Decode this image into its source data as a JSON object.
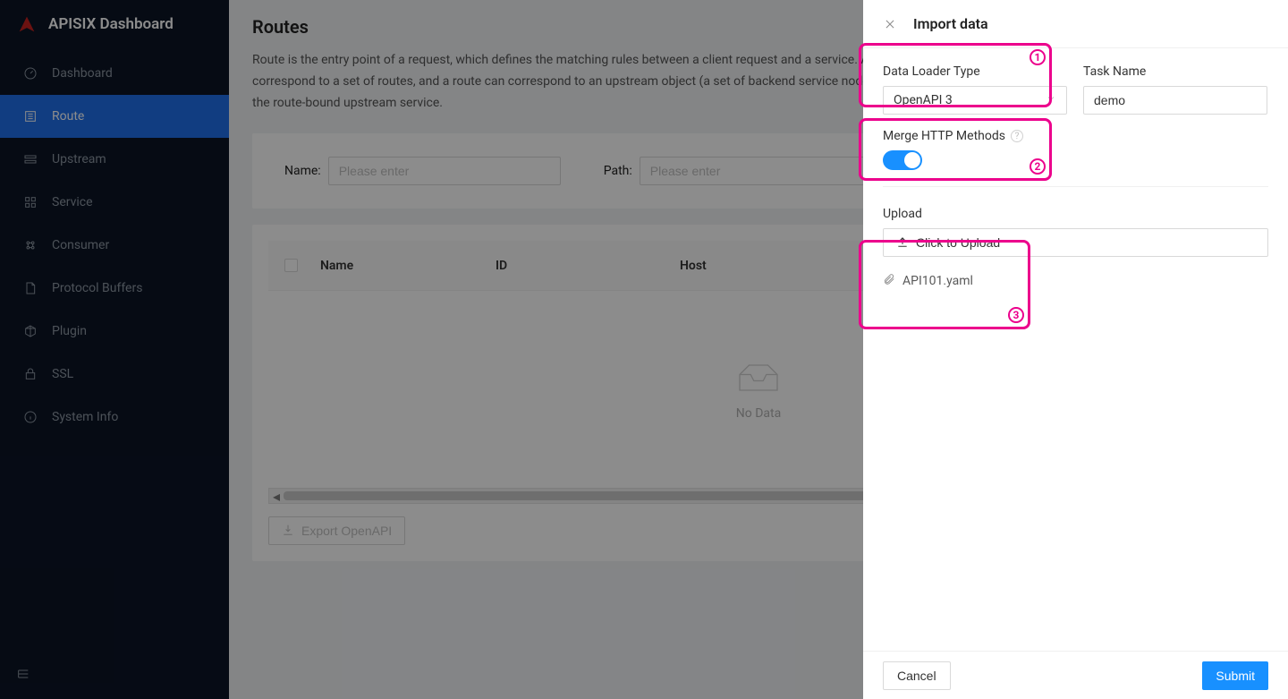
{
  "brand": {
    "title": "APISIX Dashboard"
  },
  "sidebar": {
    "items": [
      {
        "label": "Dashboard",
        "icon": "gauge"
      },
      {
        "label": "Route",
        "icon": "route",
        "active": true
      },
      {
        "label": "Upstream",
        "icon": "upstream"
      },
      {
        "label": "Service",
        "icon": "grid"
      },
      {
        "label": "Consumer",
        "icon": "consumer"
      },
      {
        "label": "Protocol Buffers",
        "icon": "file"
      },
      {
        "label": "Plugin",
        "icon": "cube"
      },
      {
        "label": "SSL",
        "icon": "lock"
      },
      {
        "label": "System Info",
        "icon": "info"
      }
    ]
  },
  "page": {
    "title": "Routes",
    "description": "Route is the entry point of a request, which defines the matching rules between a client request and a service. A route can be associated with a service (Upstream), a service can correspond to a set of routes, and a route can correspond to an upstream object (a set of backend service nodes), so each request matching a route will be proxied by the gateway to the route-bound upstream service."
  },
  "filter": {
    "name_label": "Name:",
    "name_placeholder": "Please enter",
    "path_label": "Path:",
    "path_placeholder": "Please enter"
  },
  "table": {
    "columns": {
      "name": "Name",
      "id": "ID",
      "host": "Host"
    },
    "empty": "No Data",
    "export_label": "Export OpenAPI"
  },
  "drawer": {
    "title": "Import data",
    "loader_label": "Data Loader Type",
    "loader_value": "OpenAPI 3",
    "task_label": "Task Name",
    "task_value": "demo",
    "merge_label": "Merge HTTP Methods",
    "merge_on": true,
    "upload_label": "Upload",
    "upload_button": "Click to Upload",
    "file_name": "API101.yaml",
    "cancel": "Cancel",
    "submit": "Submit"
  },
  "callouts": {
    "c1": "1",
    "c2": "2",
    "c3": "3"
  }
}
